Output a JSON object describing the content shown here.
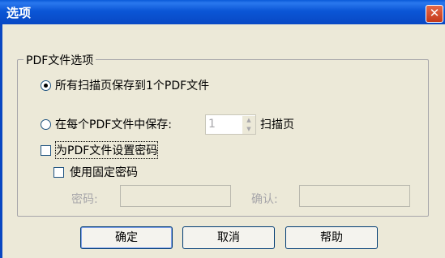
{
  "window": {
    "title": "选项",
    "close_glyph": "✕"
  },
  "group": {
    "legend": "PDF文件选项"
  },
  "options": {
    "radio_all_label": "所有扫描页保存到1个PDF文件",
    "radio_all_selected": true,
    "radio_each_label": "在每个PDF文件中保存:",
    "radio_each_selected": false,
    "pages_value": "1",
    "pages_suffix": "扫描页",
    "set_password_label": "为PDF文件设置密码",
    "set_password_checked": false,
    "fixed_password_label": "使用固定密码",
    "fixed_password_checked": false,
    "password_label": "密码:",
    "password_value": "",
    "confirm_label": "确认:",
    "confirm_value": ""
  },
  "buttons": {
    "ok": "确定",
    "cancel": "取消",
    "help": "帮助"
  }
}
